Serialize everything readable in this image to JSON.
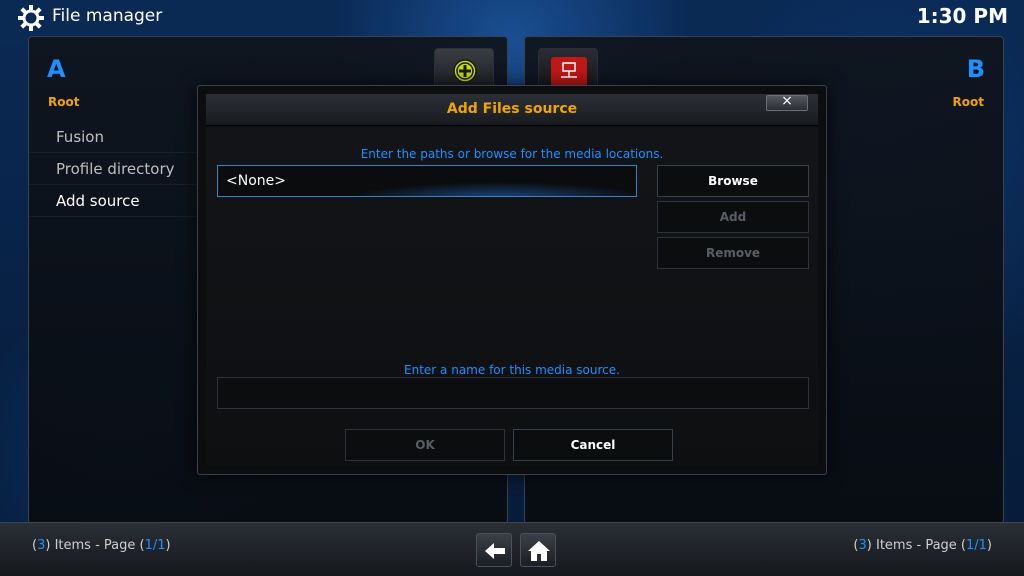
{
  "header": {
    "app_title": "File manager",
    "clock": "1:30 PM",
    "icon": "gear-icon"
  },
  "left_pane": {
    "letter": "A",
    "root_label": "Root",
    "items": [
      {
        "label": "Fusion"
      },
      {
        "label": "Profile directory"
      },
      {
        "label": "Add source"
      }
    ],
    "footer": {
      "count": "3",
      "text": " Items - Page ",
      "page": "1/1"
    }
  },
  "right_pane": {
    "letter": "B",
    "root_label": "Root",
    "footer": {
      "count": "3",
      "text": " Items - Page ",
      "page": "1/1"
    }
  },
  "top_icons": [
    "add-source-icon",
    "network-icon"
  ],
  "nav": {
    "back_icon": "back-arrow-icon",
    "home_icon": "home-icon"
  },
  "dialog": {
    "title": "Add Files source",
    "close_label": "×",
    "paths_hint": "Enter the paths or browse for the media locations.",
    "path_value": "<None>",
    "browse_label": "Browse",
    "add_label": "Add",
    "remove_label": "Remove",
    "name_hint": "Enter a name for this media source.",
    "name_value": "",
    "ok_label": "OK",
    "cancel_label": "Cancel"
  },
  "colors": {
    "accent_blue": "#1e90ff",
    "title_orange": "#f0a400",
    "disabled_text": "#5a5e64"
  }
}
